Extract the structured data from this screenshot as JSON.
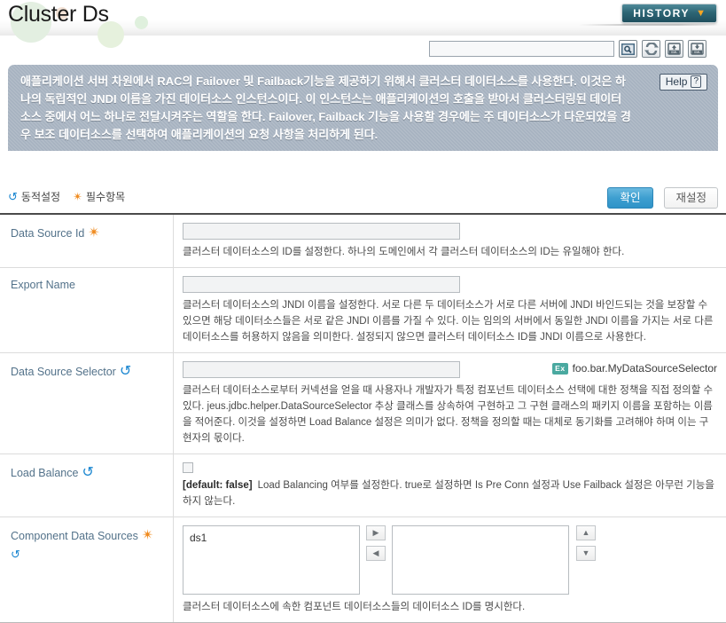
{
  "header": {
    "title": "Cluster Ds",
    "history_label": "HISTORY",
    "history_chevron": "chevron-down-icon"
  },
  "search": {
    "value": "",
    "placeholder": "",
    "buttons": [
      {
        "name": "search-icon",
        "title": "Search"
      },
      {
        "name": "refresh-icon",
        "title": "Refresh"
      },
      {
        "name": "xml-upload-icon",
        "title": "XML Upload"
      },
      {
        "name": "xml-download-icon",
        "title": "XML Download"
      }
    ]
  },
  "description": {
    "text": "애플리케이션 서버 차원에서 RAC의 Failover 및 Failback기능을 제공하기 위해서 클러스터 데이터소스를 사용한다. 이것은 하나의 독립적인 JNDI 이름을 가진 데이터소스 인스턴스이다. 이 인스턴스는 애플리케이션의 호출을 받아서 클러스터링된 데이터소스 중에서 어느 하나로 전달시켜주는 역할을 한다. Failover, Failback 기능을 사용할 경우에는 주 데이터소스가 다운되었을 경우 보조 데이터소스를 선택하여 애플리케이션의 요청 사항을 처리하게 된다.",
    "help_label": "Help",
    "help_mark": "?"
  },
  "toolbar": {
    "legend_dynamic": "동적설정",
    "legend_required": "필수항목",
    "confirm_label": "확인",
    "reset_label": "재설정"
  },
  "colors": {
    "accent_blue": "#1a86d0",
    "required_orange": "#f08a1d",
    "label_slate": "#53728a",
    "panel_bg": "#a6b2c0",
    "primary_btn": "#3e9fd0",
    "ex_badge": "#4aa9a0",
    "history_btn": "#2e6675"
  },
  "fields": [
    {
      "label": "Data Source Id",
      "required": true,
      "dynamic": false,
      "dynamic_below": false,
      "value": "",
      "description": "클러스터 데이터소스의 ID를 설정한다. 하나의 도메인에서 각 클러스터 데이터소스의 ID는 유일해야 한다."
    },
    {
      "label": "Export Name",
      "required": false,
      "dynamic": false,
      "dynamic_below": false,
      "value": "",
      "description": "클러스터 데이터소스의 JNDI 이름을 설정한다. 서로 다른 두 데이터소스가 서로 다른 서버에 JNDI 바인드되는 것을 보장할 수 있으면 해당 데이터소스들은 서로 같은 JNDI 이름를 가질 수 있다. 이는 임의의 서버에서 동일한 JNDI 이름을 가지는 서로 다른 데이터소스를 허용하지 않음을 의미한다. 설정되지 않으면 클러스터 데이터소스 ID를 JNDI 이름으로 사용한다."
    },
    {
      "label": "Data Source Selector",
      "required": false,
      "dynamic": true,
      "dynamic_below": false,
      "value": "",
      "example_badge": "Ex",
      "example_text": "foo.bar.MyDataSourceSelector",
      "description": "클러스터 데이터소스로부터 커넥션을 얻을 때 사용자나 개발자가 특정 컴포넌트 데이터소스 선택에 대한 정책을 직접 정의할 수 있다. jeus.jdbc.helper.DataSourceSelector 추상 클래스를 상속하여 구현하고 그 구현 클래스의 패키지 이름을 포함하는 이름을 적어준다. 이것을 설정하면 Load Balance 설정은 의미가 없다. 정책을 정의할 때는 대체로 동기화를 고려해야 하며 이는 구현자의 몫이다."
    },
    {
      "label": "Load Balance",
      "required": false,
      "dynamic": true,
      "dynamic_below": false,
      "checkbox": true,
      "checked": false,
      "default_tag": "[default: false]",
      "description": "Load Balancing 여부를 설정한다. true로 설정하면 Is Pre Conn 설정과 Use Failback 설정은 아무런 기능을 하지 않는다."
    },
    {
      "label": "Component Data Sources",
      "required": true,
      "dynamic": false,
      "dynamic_below": true,
      "dual_list": {
        "available": [
          "ds1"
        ],
        "selected": [],
        "btn_add": "▶",
        "btn_remove": "◀",
        "btn_up": "▲",
        "btn_down": "▼"
      },
      "description": "클러스터 데이터소스에 속한 컴포넌트 데이터소스들의 데이터소스 ID를 명시한다."
    }
  ]
}
